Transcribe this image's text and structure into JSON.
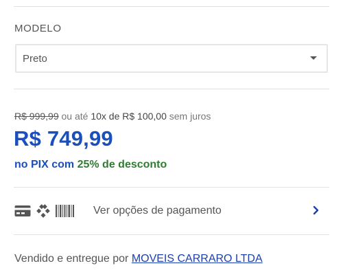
{
  "modelo": {
    "label": "MODELO",
    "selected": "Preto"
  },
  "price": {
    "old_price": "R$ 999,99",
    "connector": "ou até",
    "installments": "10x de R$ 100,00",
    "no_interest": "sem juros",
    "main_price": "R$ 749,99",
    "pix_prefix": "no PIX com",
    "pix_discount": "25% de desconto"
  },
  "payment": {
    "icons": [
      "credit-card-icon",
      "pix-icon",
      "barcode-icon"
    ],
    "label": "Ver opções de pagamento"
  },
  "seller": {
    "prefix": "Vendido e entregue por",
    "name": "MOVEIS CARRARO LTDA"
  },
  "colors": {
    "price_blue": "#1a4fbd",
    "discount_green": "#2e7d32",
    "link_blue": "#1a3fae"
  }
}
